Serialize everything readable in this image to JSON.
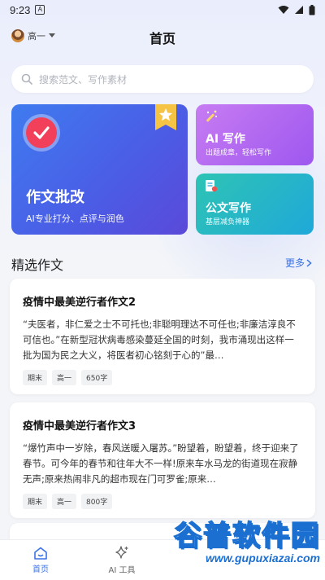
{
  "status_bar": {
    "time": "9:23",
    "notif_glyph": "A"
  },
  "header": {
    "grade": "高一",
    "title": "首页"
  },
  "search": {
    "placeholder": "搜索范文、写作素材"
  },
  "feature_cards": {
    "correction": {
      "title": "作文批改",
      "subtitle": "AI专业打分、点评与润色"
    },
    "ai_writing": {
      "title": "AI 写作",
      "subtitle": "出题成章，轻松写作"
    },
    "doc_writing": {
      "title": "公文写作",
      "subtitle": "基层减负神器"
    }
  },
  "featured": {
    "section_title": "精选作文",
    "more_label": "更多",
    "essays": [
      {
        "title": "疫情中最美逆行者作文2",
        "excerpt": "“夫医者，非仁爱之士不可托也;非聪明理达不可任也;非廉洁淳良不可信也。”在新型冠状病毒感染蔓延全国的时刻，我市涌现出这样一批为国为民之大义，将医者初心铭刻于心的”最…",
        "tags": [
          "期末",
          "高一",
          "650字"
        ]
      },
      {
        "title": "疫情中最美逆行者作文3",
        "excerpt": "“爆竹声中一岁除，春风送暖入屠苏。”盼望着，盼望着，终于迎来了春节。可今年的春节和往年大不一样!原来车水马龙的街道现在寂静无声;原来热闹非凡的超市现在门可罗雀;原来…",
        "tags": [
          "期末",
          "高一",
          "800字"
        ]
      }
    ]
  },
  "bottom_nav": {
    "items": [
      {
        "label": "首页",
        "icon": "home-icon",
        "active": true
      },
      {
        "label": "AI 工具",
        "icon": "sparkle-icon",
        "active": false
      }
    ]
  },
  "watermark": {
    "text": "谷普软件园",
    "url": "www.gupuxiazai.com"
  },
  "colors": {
    "accent": "#3b73e6",
    "correction_card": "#4a5ee6",
    "ai_card": "#b46af0",
    "doc_card": "#22b6c8",
    "check_badge": "#f2405a"
  }
}
